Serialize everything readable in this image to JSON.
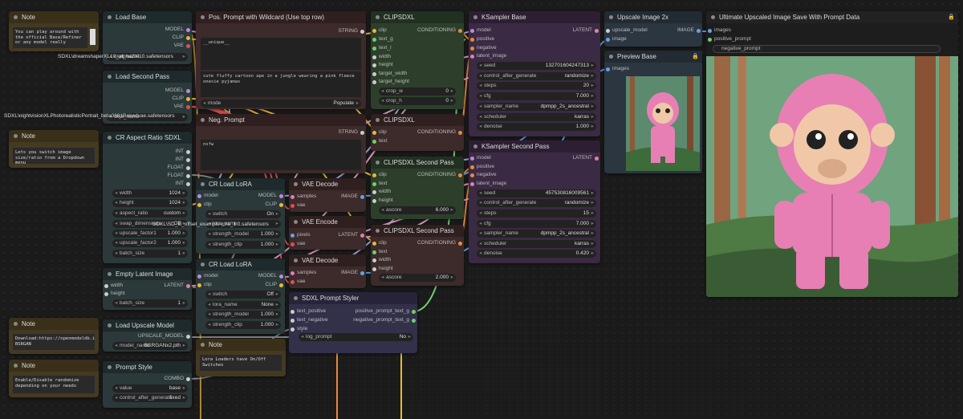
{
  "colors": {
    "accent": "#e8b83c",
    "teal": "#2b393a",
    "green": "#2d3f2b",
    "maroon": "#3d2a2a",
    "purple": "#3b2a43"
  },
  "notes": {
    "n1": {
      "title": "Note",
      "text": "You can play around with the official Base/Refiner or any model really"
    },
    "n2": {
      "title": "Note",
      "text": "Lets you switch image size/ratio from a Dropdown menu"
    },
    "n3": {
      "title": "Note",
      "text": "Download:https://openmodeldb.info/models/2x-BSRGAN"
    },
    "n4": {
      "title": "Note",
      "text": "Enable/Disable randomize depending on your needs"
    },
    "n5": {
      "title": "Note",
      "text": "Lora Loaders have On/Off Switches"
    }
  },
  "load_base": {
    "title": "Load Base",
    "o1": "MODEL",
    "o2": "CLIP",
    "o3": "VAE",
    "ckpt_label": "ckpt_name",
    "ckpt": "SDXL\\dreamshaperXL10_alpha2Xl10.safetensors"
  },
  "load_second": {
    "title": "Load Second Pass",
    "o1": "MODEL",
    "o2": "CLIP",
    "o3": "VAE",
    "ckpt_label": "ckpt_name",
    "ckpt": "SDXL\\nightvisionXLPhotorealisticPortrait_beta0681Bakedvae.safetensors"
  },
  "aspect": {
    "title": "CR Aspect Ratio SDXL",
    "outs": [
      "INT",
      "INT",
      "FLOAT",
      "FLOAT",
      "INT"
    ],
    "w": [
      {
        "l": "width",
        "v": "1024"
      },
      {
        "l": "height",
        "v": "1024"
      },
      {
        "l": "aspect_ratio",
        "v": "custom"
      },
      {
        "l": "swap_dimensions",
        "v": "Off"
      },
      {
        "l": "upscale_factor1",
        "v": "1.000"
      },
      {
        "l": "upscale_factor2",
        "v": "1.000"
      },
      {
        "l": "batch_size",
        "v": "1"
      }
    ]
  },
  "empty_latent": {
    "title": "Empty Latent Image",
    "i1": "width",
    "i2": "height",
    "o1": "LATENT",
    "w1l": "batch_size",
    "w1v": "1"
  },
  "upscale_model": {
    "title": "Load Upscale Model",
    "o1": "UPSCALE_MODEL",
    "wl": "model_name",
    "wv": "BSRGANx2.pth"
  },
  "prompt_style": {
    "title": "Prompt Style",
    "o1": "COMBO",
    "w": [
      {
        "l": "value",
        "v": "base"
      },
      {
        "l": "control_after_generate",
        "v": "fixed"
      }
    ]
  },
  "pos_prompt": {
    "title": "Pos. Prompt with Wildcard (Use top row)",
    "o1": "STRING",
    "t1": "__unique__",
    "t2": "cute fluffy cartoon ape in a jungle wearing a pink fleece onesie pyjamas",
    "mode": "mode",
    "populate": "Populate"
  },
  "neg_prompt": {
    "title": "Neg. Prompt",
    "o1": "STRING",
    "t1": "nsfw"
  },
  "lora1": {
    "title": "CR Load LoRA",
    "i1": "model",
    "i2": "clip",
    "o1": "MODEL",
    "o2": "CLIP",
    "lora": "SDXL\\SD_xl_offset_example-lora_1.0.safetensors",
    "w": [
      {
        "l": "switch",
        "v": "On"
      },
      {
        "l": "lora_name",
        "v": ""
      },
      {
        "l": "strength_model",
        "v": "1.000"
      },
      {
        "l": "strength_clip",
        "v": "1.000"
      }
    ]
  },
  "lora2": {
    "title": "CR Load LoRA",
    "i1": "model",
    "i2": "clip",
    "o1": "MODEL",
    "o2": "CLIP",
    "w": [
      {
        "l": "switch",
        "v": "Off"
      },
      {
        "l": "lora_name",
        "v": "None"
      },
      {
        "l": "strength_model",
        "v": "1.000"
      },
      {
        "l": "strength_clip",
        "v": "1.000"
      }
    ]
  },
  "vae_decode1": {
    "title": "VAE Decode",
    "i1": "samples",
    "i2": "vae",
    "o1": "IMAGE"
  },
  "vae_encode": {
    "title": "VAE Encode",
    "i1": "pixels",
    "i2": "vae",
    "o1": "LATENT"
  },
  "vae_decode2": {
    "title": "VAE Decode",
    "i1": "samples",
    "i2": "vae",
    "o1": "IMAGE"
  },
  "styler": {
    "title": "SDXL Prompt Styler",
    "i1": "text_positive",
    "i2": "text_negative",
    "i3": "style",
    "o1": "positive_prompt_text_g",
    "o2": "negative_prompt_text_g",
    "wl": "log_prompt",
    "wv": "No"
  },
  "clip1": {
    "title": "CLIPSDXL",
    "o1": "CONDITIONING",
    "ins": [
      "clip",
      "text_g",
      "text_l",
      "width",
      "height",
      "target_width",
      "target_height"
    ],
    "w": [
      {
        "l": "crop_w",
        "v": "0"
      },
      {
        "l": "crop_h",
        "v": "0"
      }
    ]
  },
  "clip2": {
    "title": "CLIPSDXL",
    "o1": "CONDITIONING",
    "ins": [
      "clip",
      "text"
    ]
  },
  "clip3": {
    "title": "CLIPSDXL Second Pass",
    "o1": "CONDITIONING",
    "ins": [
      "clip",
      "text",
      "width",
      "height"
    ],
    "wl": "ascore",
    "wv": "6.000"
  },
  "clip4": {
    "title": "CLIPSDXL Second Pass",
    "o1": "CONDITIONING",
    "ins": [
      "clip",
      "text",
      "width",
      "height"
    ],
    "wl": "ascore",
    "wv": "2.000"
  },
  "ksampler1": {
    "title": "KSampler Base",
    "o1": "LATENT",
    "ins": [
      "model",
      "positive",
      "negative",
      "latent_image"
    ],
    "w": [
      {
        "l": "seed",
        "v": "132701604247313"
      },
      {
        "l": "control_after_generate",
        "v": "randomize"
      },
      {
        "l": "steps",
        "v": "20"
      },
      {
        "l": "cfg",
        "v": "7.000"
      },
      {
        "l": "sampler_name",
        "v": "dpmpp_2s_ancestral"
      },
      {
        "l": "scheduler",
        "v": "karras"
      },
      {
        "l": "denoise",
        "v": "1.000"
      }
    ]
  },
  "ksampler2": {
    "title": "KSampler Second Pass",
    "o1": "LATENT",
    "ins": [
      "model",
      "positive",
      "negative",
      "latent_image"
    ],
    "w": [
      {
        "l": "seed",
        "v": "457530816009561"
      },
      {
        "l": "control_after_generate",
        "v": "randomize"
      },
      {
        "l": "steps",
        "v": "15"
      },
      {
        "l": "cfg",
        "v": "7.000"
      },
      {
        "l": "sampler_name",
        "v": "dpmpp_2s_ancestral"
      },
      {
        "l": "scheduler",
        "v": "karras"
      },
      {
        "l": "denoise",
        "v": "0.420"
      }
    ]
  },
  "upscale": {
    "title": "Upscale Image 2x",
    "i1": "upscale_model",
    "i2": "image",
    "o1": "IMAGE"
  },
  "preview": {
    "title": "Preview Base",
    "i1": "images"
  },
  "save": {
    "title": "Ultimate Upscaled Image Save With Prompt Data",
    "i1": "images",
    "i2": "positive_prompt",
    "w1": "negative_prompt"
  }
}
